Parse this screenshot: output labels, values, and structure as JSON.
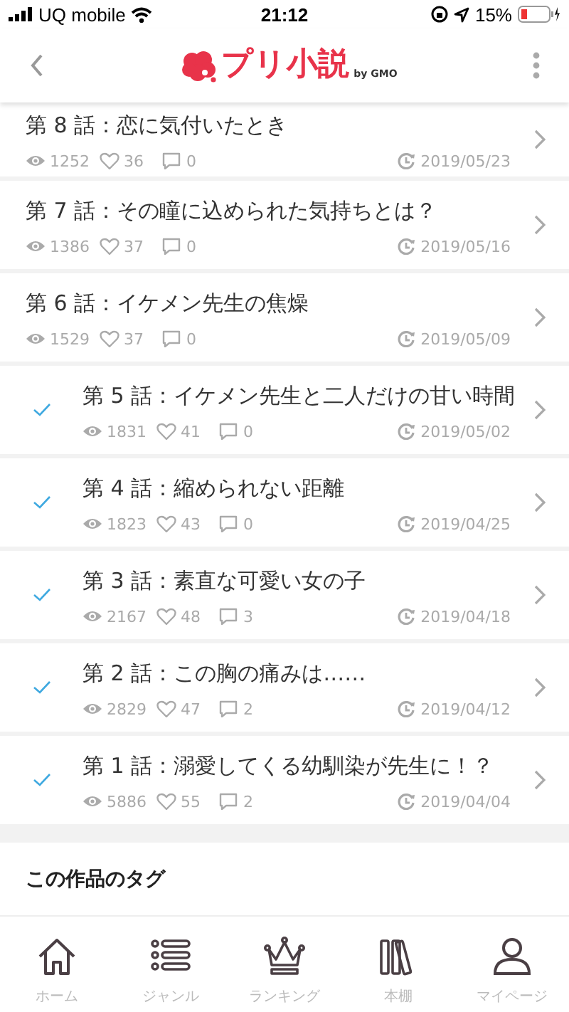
{
  "status_bar": {
    "carrier": "UQ mobile",
    "time": "21:12",
    "battery": "15%"
  },
  "header": {
    "logo": "プリ小説",
    "logo_sub": "by GMO"
  },
  "episodes": [
    {
      "title": "第 8 話：恋に気付いたとき",
      "views": "1252",
      "likes": "36",
      "comments": "0",
      "date": "2019/05/23",
      "read": false
    },
    {
      "title": "第 7 話：その瞳に込められた気持ちとは？",
      "views": "1386",
      "likes": "37",
      "comments": "0",
      "date": "2019/05/16",
      "read": false
    },
    {
      "title": "第 6 話：イケメン先生の焦燥",
      "views": "1529",
      "likes": "37",
      "comments": "0",
      "date": "2019/05/09",
      "read": false
    },
    {
      "title": "第 5 話：イケメン先生と二人だけの甘い時間",
      "views": "1831",
      "likes": "41",
      "comments": "0",
      "date": "2019/05/02",
      "read": true
    },
    {
      "title": "第 4 話：縮められない距離",
      "views": "1823",
      "likes": "43",
      "comments": "0",
      "date": "2019/04/25",
      "read": true
    },
    {
      "title": "第 3 話：素直な可愛い女の子",
      "views": "2167",
      "likes": "48",
      "comments": "3",
      "date": "2019/04/18",
      "read": true
    },
    {
      "title": "第 2 話：この胸の痛みは……",
      "views": "2829",
      "likes": "47",
      "comments": "2",
      "date": "2019/04/12",
      "read": true
    },
    {
      "title": "第 1 話：溺愛してくる幼馴染が先生に！？",
      "views": "5886",
      "likes": "55",
      "comments": "2",
      "date": "2019/04/04",
      "read": true
    }
  ],
  "tags_section": {
    "title": "この作品のタグ"
  },
  "tab_bar": [
    {
      "kind": "home",
      "label": "ホーム"
    },
    {
      "kind": "genre",
      "label": "ジャンル"
    },
    {
      "kind": "ranking",
      "label": "ランキング"
    },
    {
      "kind": "shelf",
      "label": "本棚"
    },
    {
      "kind": "mypage",
      "label": "マイページ"
    }
  ]
}
